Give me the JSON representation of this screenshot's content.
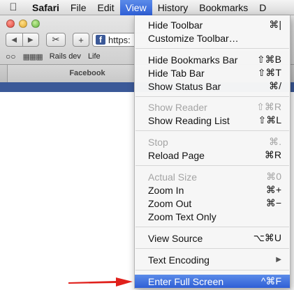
{
  "menubar": {
    "items": [
      "Safari",
      "File",
      "Edit",
      "View",
      "History",
      "Bookmarks",
      "D"
    ]
  },
  "toolbar": {
    "add_label": "+",
    "url_text": "https:",
    "favicon_letter": "f"
  },
  "bookmarks_bar": {
    "items": [
      "Rails dev",
      "Life"
    ]
  },
  "tab": {
    "title": "Facebook"
  },
  "view_menu": {
    "items": [
      {
        "label": "Hide Toolbar",
        "shortcut": "⌘|"
      },
      {
        "label": "Customize Toolbar…",
        "shortcut": ""
      },
      {
        "label": "Hide Bookmarks Bar",
        "shortcut": "⇧⌘B"
      },
      {
        "label": "Hide Tab Bar",
        "shortcut": "⇧⌘T"
      },
      {
        "label": "Show Status Bar",
        "shortcut": "⌘/"
      },
      {
        "label": "Show Reader",
        "shortcut": "⇧⌘R"
      },
      {
        "label": "Show Reading List",
        "shortcut": "⇧⌘L"
      },
      {
        "label": "Stop",
        "shortcut": "⌘."
      },
      {
        "label": "Reload Page",
        "shortcut": "⌘R"
      },
      {
        "label": "Actual Size",
        "shortcut": "⌘0"
      },
      {
        "label": "Zoom In",
        "shortcut": "⌘+"
      },
      {
        "label": "Zoom Out",
        "shortcut": "⌘−"
      },
      {
        "label": "Zoom Text Only",
        "shortcut": ""
      },
      {
        "label": "View Source",
        "shortcut": "⌥⌘U"
      },
      {
        "label": "Text Encoding",
        "shortcut": "▶"
      },
      {
        "label": "Enter Full Screen",
        "shortcut": "^⌘F"
      }
    ]
  },
  "colors": {
    "highlight": "#3a6ddc",
    "arrow": "#e0201b",
    "facebook_blue": "#3b5998"
  }
}
